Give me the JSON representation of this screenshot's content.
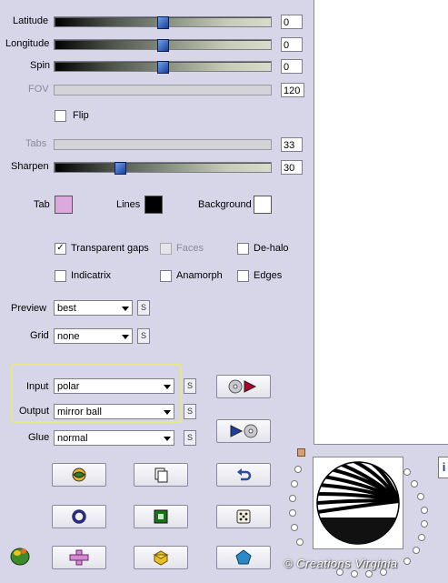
{
  "sliders": [
    {
      "label": "Latitude",
      "value": "0",
      "fraction": 0.5,
      "disabled": false
    },
    {
      "label": "Longitude",
      "value": "0",
      "fraction": 0.5,
      "disabled": false
    },
    {
      "label": "Spin",
      "value": "0",
      "fraction": 0.5,
      "disabled": false
    },
    {
      "label": "FOV",
      "value": "120",
      "fraction": null,
      "disabled": true
    },
    {
      "label": "Tabs",
      "value": "33",
      "fraction": null,
      "disabled": true
    },
    {
      "label": "Sharpen",
      "value": "30",
      "fraction": 0.3,
      "disabled": false
    }
  ],
  "flip": {
    "label": "Flip",
    "checked": false
  },
  "colors": {
    "tab": {
      "label": "Tab",
      "color": "#dda8dd"
    },
    "lines": {
      "label": "Lines",
      "color": "#000000"
    },
    "background": {
      "label": "Background",
      "color": "#ffffff"
    }
  },
  "options": {
    "transparent_gaps": {
      "label": "Transparent gaps",
      "checked": true
    },
    "faces": {
      "label": "Faces",
      "checked": false,
      "disabled": true
    },
    "de_halo": {
      "label": "De-halo",
      "checked": false
    },
    "indicatrix": {
      "label": "Indicatrix",
      "checked": false
    },
    "anamorph": {
      "label": "Anamorph",
      "checked": false
    },
    "edges": {
      "label": "Edges",
      "checked": false
    }
  },
  "selects": {
    "preview": {
      "label": "Preview",
      "value": "best"
    },
    "grid": {
      "label": "Grid",
      "value": "none"
    },
    "input": {
      "label": "Input",
      "value": "polar"
    },
    "output": {
      "label": "Output",
      "value": "mirror ball"
    },
    "glue": {
      "label": "Glue",
      "value": "normal"
    }
  },
  "small_button_label": "S",
  "side_tab": "i",
  "watermark": "© Creations Virginia",
  "accent": "#e6e888"
}
